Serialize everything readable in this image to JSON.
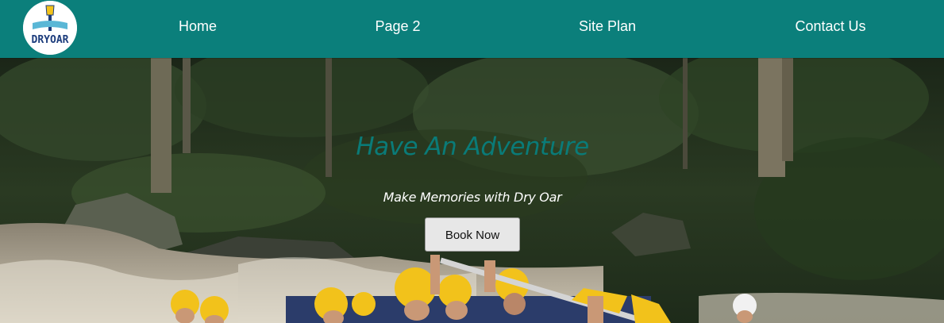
{
  "brand": {
    "logo_text": "DRYOAR",
    "colors": {
      "primary": "#0b7f7b",
      "title": "#0a7b78",
      "button_bg": "#e7e7e7"
    }
  },
  "nav": {
    "items": [
      {
        "label": "Home"
      },
      {
        "label": "Page 2"
      },
      {
        "label": "Site Plan"
      },
      {
        "label": "Contact Us"
      }
    ]
  },
  "hero": {
    "title": "Have An Adventure",
    "subtitle": "Make Memories with Dry Oar",
    "button_label": "Book Now",
    "background": "rafting-photo"
  }
}
